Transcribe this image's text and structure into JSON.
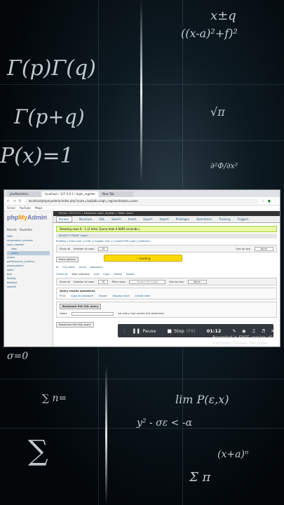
{
  "background": {
    "formulas": [
      "x±q",
      "((x-a)²+f)²",
      "Γ(p)Γ(q)",
      "Γ(p+q)",
      "P(x)=1",
      "√π",
      "∂²Φ/∂x²",
      "lim P(ε,x)",
      "y² - σε < -α",
      "∑",
      "(x+a)ⁿ",
      "Σ π",
      "σ=0",
      "∑ n="
    ]
  },
  "browser": {
    "tabs": [
      "phpMyAdmin",
      "localhost / 127.0.0.1 / login_register",
      "New Tab"
    ],
    "url": "localhost/phpmyadmin/index.php?route=/sql&db=login_register&table=users",
    "bookmarks": [
      "Gmail",
      "YouTube",
      "Maps"
    ]
  },
  "pma": {
    "logo_php": "php",
    "logo_my": "My",
    "logo_admin": "Admin",
    "side_tabs": [
      "Recent",
      "Favorites"
    ],
    "tree": [
      "New",
      "information_schema",
      "login_register",
      "New",
      "users",
      "mysql",
      "performance_schema",
      "phpmyadmin",
      "sakm",
      "test",
      "testing",
      "testing1",
      "webfell"
    ],
    "breadcrumb": "Server: 127.0.0.1 » Database: login_register » Table: users",
    "menu": [
      "Browse",
      "Structure",
      "SQL",
      "Search",
      "Insert",
      "Export",
      "Import",
      "Privileges",
      "Operations",
      "Tracking",
      "Triggers"
    ],
    "success": "Showing rows 0 - 1 (2 total, Query took 0.0005 seconds.)",
    "sql_text": "SELECT * FROM `users`",
    "profiling": "Profiling [ Edit inline ] [ Edit ] [ Explain SQL ] [ Create PHP code ] [ Refresh ]",
    "show_all": "Show all",
    "number_of_rows": "Number of rows:",
    "rows_value": "25",
    "filter_rows": "Filter rows:",
    "filter_placeholder": "Search this table",
    "sort_by_key": "Sort by key:",
    "sort_value": "None",
    "loading": "Loading",
    "extra_options": "Extra options",
    "columns": [
      "id",
      "full_name",
      "email",
      "password"
    ],
    "row_actions": [
      "Check all",
      "With selected:",
      "Edit",
      "Copy",
      "Delete",
      "Export"
    ],
    "query_ops_title": "Query results operations",
    "query_ops": [
      "Print",
      "Copy to clipboard",
      "Export",
      "Display chart",
      "Create view"
    ],
    "bookmark_title": "Bookmark this SQL query",
    "label_field": "Label:",
    "let_every_user": "Let every user access this bookmark",
    "bookmark_btn": "Bookmark this SQL query"
  },
  "recorder": {
    "pause": "Pause",
    "stop": "Stop",
    "stop_hint": "(F8)",
    "time": "01:12",
    "watermark_line1": "Recorded in FREE version of",
    "watermark_line2": "Icecream Screen Recorder"
  }
}
